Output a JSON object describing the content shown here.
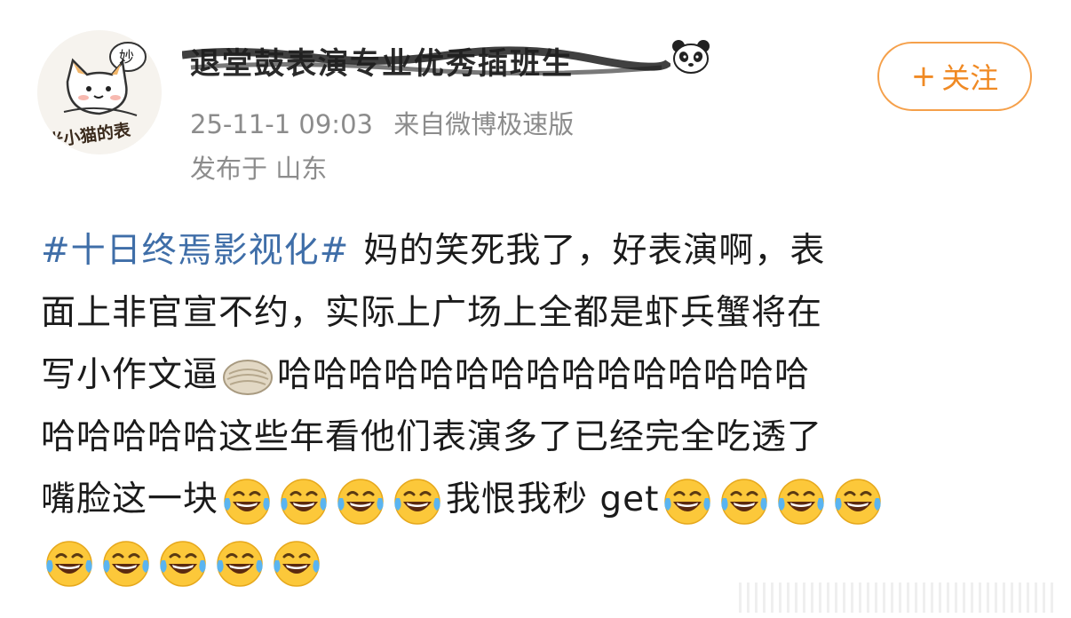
{
  "header": {
    "avatar_caption": "米小猫的表",
    "avatar_bubble": "妙",
    "username": "退堂鼓表演专业优秀插班生",
    "badge_icon": "panda-icon",
    "timestamp": "25-11-1 09:03",
    "source": "来自微博极速版",
    "location": "发布于 山东",
    "follow_plus": "+",
    "follow_label": "关注"
  },
  "post": {
    "hashtag": "#十日终焉影视化#",
    "line1_text": "妈的笑死我了，好表演啊，表",
    "line2_text": "面上非官宣不约，实际上广场上全都是虾兵蟹将在",
    "line3_text": "写小作文逼",
    "line3_emoji": "dumpling-emoji",
    "line3_text_after": "哈哈哈哈哈哈哈哈哈哈哈哈哈哈哈",
    "line4_text": "哈哈哈哈哈这些年看他们表演多了已经完全吃透了",
    "line5_text_before": "嘴脸这一块",
    "line5_text_middle": "我恨我秒 get",
    "emoji_name": "laugh-tears-emoji"
  },
  "colors": {
    "hashtag": "#3f6ea8",
    "follow": "#f08a24",
    "meta": "#8c8c8c"
  }
}
